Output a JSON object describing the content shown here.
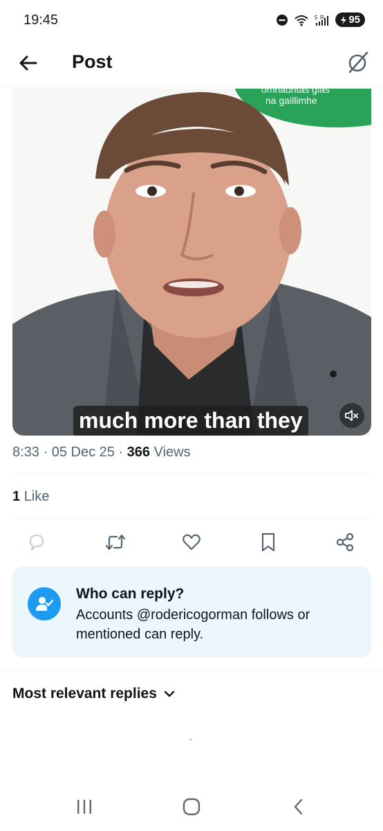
{
  "status_bar": {
    "time": "19:45",
    "battery": "95",
    "signal_label": "5 R"
  },
  "header": {
    "title": "Post",
    "back_icon": "arrow-left-icon",
    "grok_icon": "grok-icon"
  },
  "media": {
    "caption": "much more than they",
    "badge_line1": "omhaontas glas",
    "badge_line2": "na gaillimhe",
    "badge_color": "#2aa35a",
    "mute_icon": "volume-mute-icon"
  },
  "meta": {
    "time": "8:33",
    "date": "05 Dec 25",
    "views_count": "366",
    "views_label": "Views"
  },
  "likes": {
    "count": "1",
    "label": "Like"
  },
  "actions": [
    "reply-icon",
    "repost-icon",
    "like-icon",
    "bookmark-icon",
    "share-icon"
  ],
  "reply_card": {
    "title": "Who can reply?",
    "body": "Accounts @rodericogorman follows or mentioned can reply.",
    "bg_color": "#ecf7fd",
    "accent": "#1d9bf0"
  },
  "sort": {
    "label": "Most relevant replies"
  },
  "navbar": [
    "recent-apps-icon",
    "home-icon",
    "back-icon"
  ]
}
